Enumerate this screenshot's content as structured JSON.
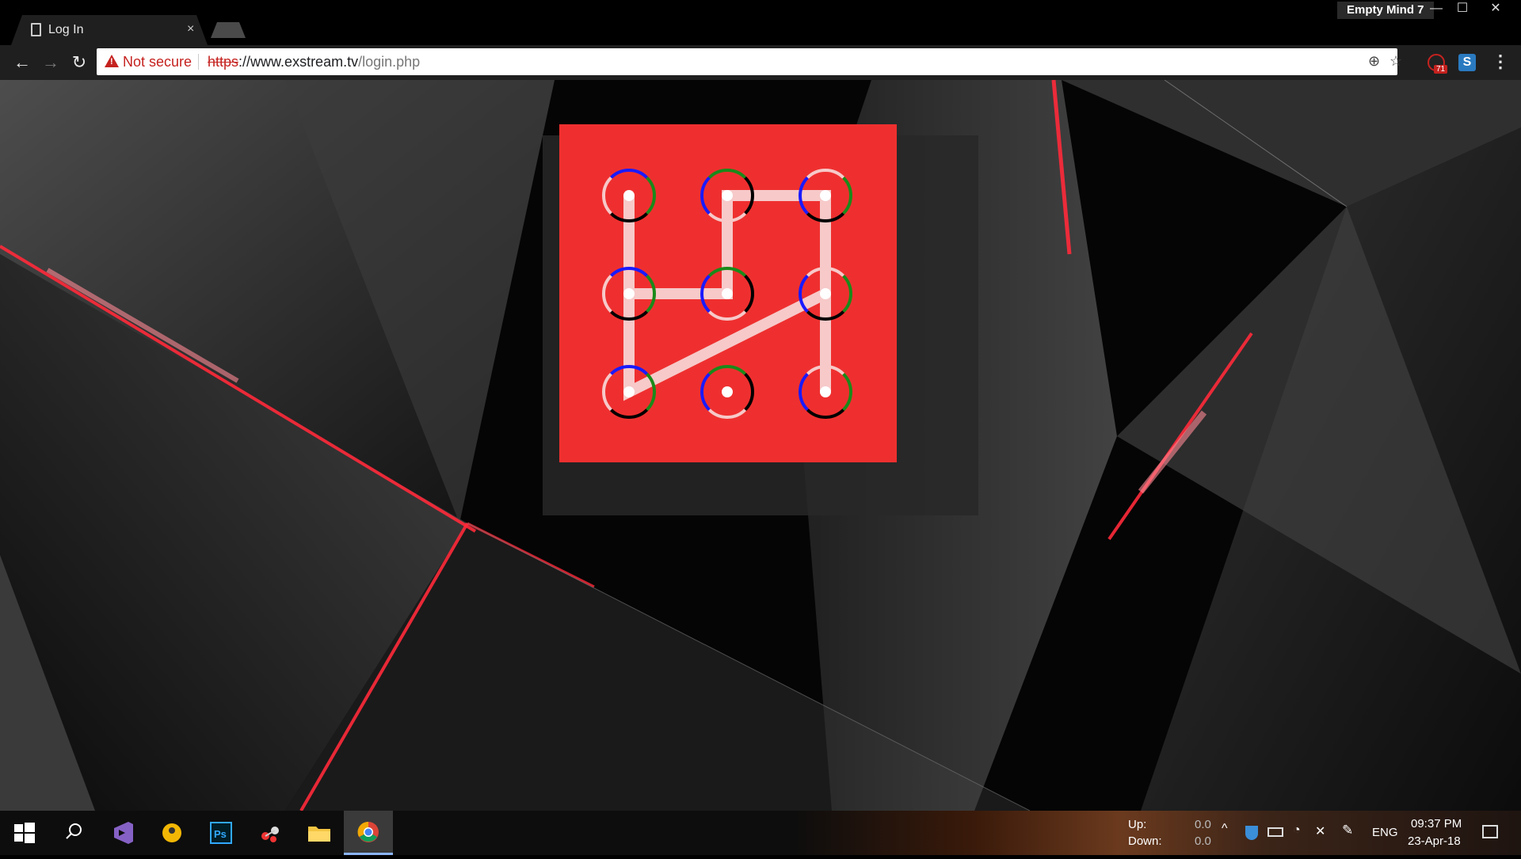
{
  "window": {
    "profile_name": "Empty Mind 7",
    "minimize": "—",
    "maximize": "☐",
    "close": "✕"
  },
  "tab": {
    "title": "Log In",
    "close": "×"
  },
  "toolbar": {
    "back": "←",
    "forward": "→",
    "reload": "↻",
    "security_label": "Not secure",
    "url_scheme": "https",
    "url_separator": "://",
    "url_host": "www.exstream.tv",
    "url_path": "/login.php",
    "zoom_icon": "⊕",
    "star_icon": "☆",
    "extension_badge": "71",
    "extension2_letter": "S",
    "menu": "⋮"
  },
  "pattern_lock": {
    "background_color": "#ef2f2f",
    "path_color": "#f7c9c9",
    "sequence": [
      1,
      7,
      6,
      9,
      3,
      2,
      5,
      4,
      1
    ],
    "note_nodes": "nodes numbered 1-9 left-to-right, top-to-bottom"
  },
  "taskbar": {
    "net_up_label": "Up:",
    "net_down_label": "Down:",
    "net_up_value": "0.0",
    "net_down_value": "0.0",
    "language": "ENG",
    "time": "09:37 PM",
    "date": "23-Apr-18"
  }
}
